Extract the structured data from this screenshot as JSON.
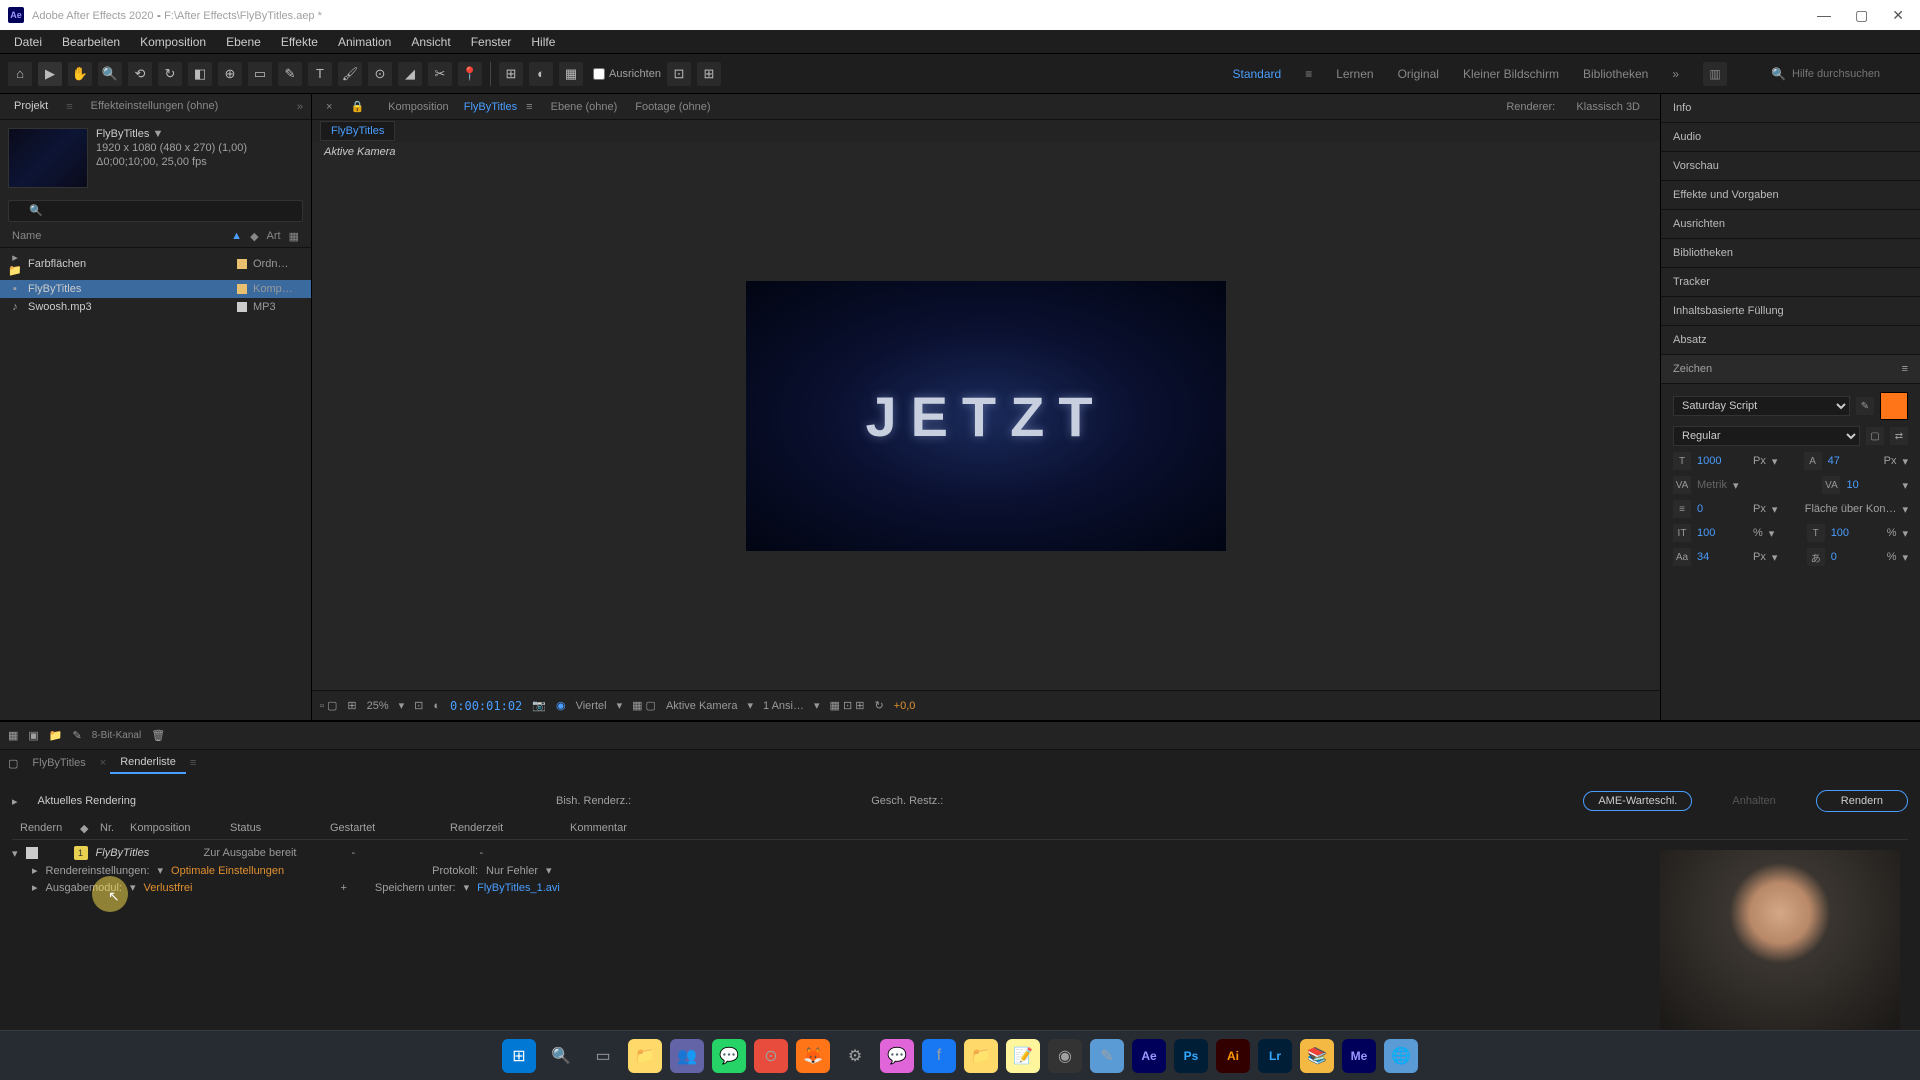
{
  "titlebar": {
    "app": "Adobe After Effects 2020",
    "path": "F:\\After Effects\\FlyByTitles.aep *"
  },
  "menu": [
    "Datei",
    "Bearbeiten",
    "Komposition",
    "Ebene",
    "Effekte",
    "Animation",
    "Ansicht",
    "Fenster",
    "Hilfe"
  ],
  "toolbar": {
    "align": "Ausrichten",
    "workspaces": [
      "Standard",
      "Lernen",
      "Original",
      "Kleiner Bildschirm",
      "Bibliotheken"
    ],
    "active_workspace": "Standard",
    "search_placeholder": "Hilfe durchsuchen"
  },
  "project": {
    "tab_project": "Projekt",
    "tab_effects": "Effekteinstellungen (ohne)",
    "comp_name": "FlyByTitles",
    "arrow": "▼",
    "meta1": "1920 x 1080 (480 x 270) (1,00)",
    "meta2": "Δ0;00;10;00, 25,00 fps",
    "col_name": "Name",
    "col_type": "Art",
    "items": [
      {
        "icon": "▸ 📁",
        "name": "Farbflächen",
        "swatch": "#e8c070",
        "type": "Ordn…"
      },
      {
        "icon": "▪",
        "name": "FlyByTitles",
        "swatch": "#e8c070",
        "type": "Komp…",
        "selected": true
      },
      {
        "icon": "♪",
        "name": "Swoosh.mp3",
        "swatch": "#ccc",
        "type": "MP3"
      }
    ]
  },
  "viewer": {
    "tab_comp_label": "Komposition",
    "tab_comp_name": "FlyByTitles",
    "tab_layer": "Ebene (ohne)",
    "tab_footage": "Footage (ohne)",
    "renderer_label": "Renderer:",
    "renderer_value": "Klassisch 3D",
    "flow_tab": "FlyByTitles",
    "active_camera": "Aktive Kamera",
    "frame_text": "JETZT",
    "zoom": "25%",
    "time": "0:00:01:02",
    "quality": "Viertel",
    "camera": "Aktive Kamera",
    "views": "1 Ansi…",
    "offset": "+0,0"
  },
  "right": {
    "panels": [
      "Info",
      "Audio",
      "Vorschau",
      "Effekte und Vorgaben",
      "Ausrichten",
      "Bibliotheken",
      "Tracker",
      "Inhaltsbasierte Füllung",
      "Absatz"
    ],
    "zeichen_label": "Zeichen",
    "font": "Saturday Script",
    "style": "Regular",
    "color": "#ff7518",
    "size": "1000",
    "size_unit": "Px",
    "leading": "47",
    "leading_unit": "Px",
    "kerning": "Metrik",
    "tracking": "10",
    "stroke": "0",
    "stroke_unit": "Px",
    "stroke_type": "Fläche über Kon…",
    "vscale": "100",
    "vscale_unit": "%",
    "hscale": "100",
    "hscale_unit": "%",
    "baseline": "34",
    "baseline_unit": "Px",
    "tsume": "0",
    "tsume_unit": "%"
  },
  "bottom": {
    "status_bitdepth": "8-Bit-Kanal",
    "tab1": "FlyByTitles",
    "tab2": "Renderliste",
    "current_label": "Aktuelles Rendering",
    "prev_label": "Bish. Renderz.:",
    "est_label": "Gesch. Restz.:",
    "ame": "AME-Warteschl.",
    "stop": "Anhalten",
    "render": "Rendern",
    "cols": {
      "render": "Rendern",
      "nr": "Nr.",
      "comp": "Komposition",
      "status": "Status",
      "started": "Gestartet",
      "time": "Renderzeit",
      "comment": "Kommentar"
    },
    "row": {
      "nr": "1",
      "comp": "FlyByTitles",
      "status": "Zur Ausgabe bereit",
      "dash": "-",
      "settings_label": "Rendereinstellungen:",
      "settings_val": "Optimale Einstellungen",
      "proto_label": "Protokoll:",
      "proto_val": "Nur Fehler",
      "module_label": "Ausgabemodul:",
      "module_val": "Verlustfrei",
      "saveas_label": "Speichern unter:",
      "saveas_val": "FlyByTitles_1.avi",
      "plus": "+"
    }
  }
}
